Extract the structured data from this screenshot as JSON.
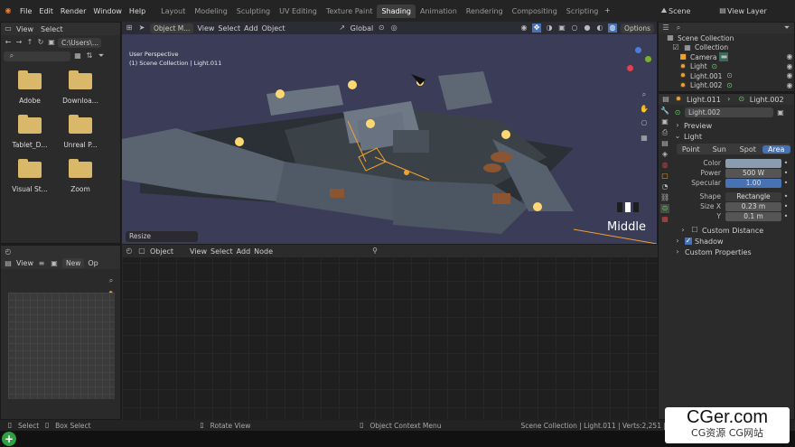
{
  "menu": [
    "File",
    "Edit",
    "Render",
    "Window",
    "Help"
  ],
  "workspaces": [
    "Layout",
    "Modeling",
    "Sculpting",
    "UV Editing",
    "Texture Paint",
    "Shading",
    "Animation",
    "Rendering",
    "Compositing",
    "Scripting"
  ],
  "active_workspace": "Shading",
  "scene": {
    "name": "Scene",
    "view_layer": "View Layer"
  },
  "file_browser": {
    "menu": [
      "View",
      "Select"
    ],
    "path": "C:\\Users\\...",
    "items": [
      "Adobe",
      "Downloa...",
      "Tablet_D...",
      "Unreal P...",
      "Visual St...",
      "Zoom"
    ]
  },
  "viewport": {
    "mode": "Object M...",
    "menus": [
      "View",
      "Select",
      "Add",
      "Object"
    ],
    "transform": "Global",
    "options": "Options",
    "perspective": "User Perspective",
    "collection_info": "(1) Scene Collection | Light.011",
    "resize": "Resize",
    "overlay_label": "Middle"
  },
  "node_editor": {
    "type": "Object",
    "menus": [
      "View",
      "Select",
      "Add",
      "Node"
    ]
  },
  "image_editor": {
    "menus": [
      "View"
    ],
    "new": "New",
    "open": "Op"
  },
  "outliner": {
    "title": "Scene Collection",
    "items": [
      {
        "name": "Collection",
        "depth": 1
      },
      {
        "name": "Camera",
        "depth": 2
      },
      {
        "name": "Light",
        "depth": 2
      },
      {
        "name": "Light.001",
        "depth": 2
      },
      {
        "name": "Light.002",
        "depth": 2
      }
    ]
  },
  "properties": {
    "object": "Light.011",
    "data": "Light.002",
    "name_field": "Light.002",
    "preview": "Preview",
    "light_section": "Light",
    "light_types": [
      "Point",
      "Sun",
      "Spot",
      "Area"
    ],
    "active_type": "Area",
    "color_label": "Color",
    "power_label": "Power",
    "power": "500 W",
    "specular_label": "Specular",
    "specular": "1.00",
    "shape_label": "Shape",
    "shape": "Rectangle",
    "size_x_label": "Size X",
    "size_x": "0.23 m",
    "y_label": "Y",
    "y": "0.1 m",
    "custom_distance": "Custom Distance",
    "shadow": "Shadow",
    "custom_properties": "Custom Properties"
  },
  "status": {
    "select": "Select",
    "box_select": "Box Select",
    "rotate": "Rotate View",
    "context": "Object Context Menu",
    "info": "Scene Collection | Light.011 | Verts:2,251 | Faces:1,850"
  },
  "watermark": {
    "main": "CGer.com",
    "sub": "CG资源 CG网站"
  },
  "colors": {
    "accent": "#4772b3",
    "light_color": "#8a9cb0",
    "orange": "#f0a030"
  }
}
